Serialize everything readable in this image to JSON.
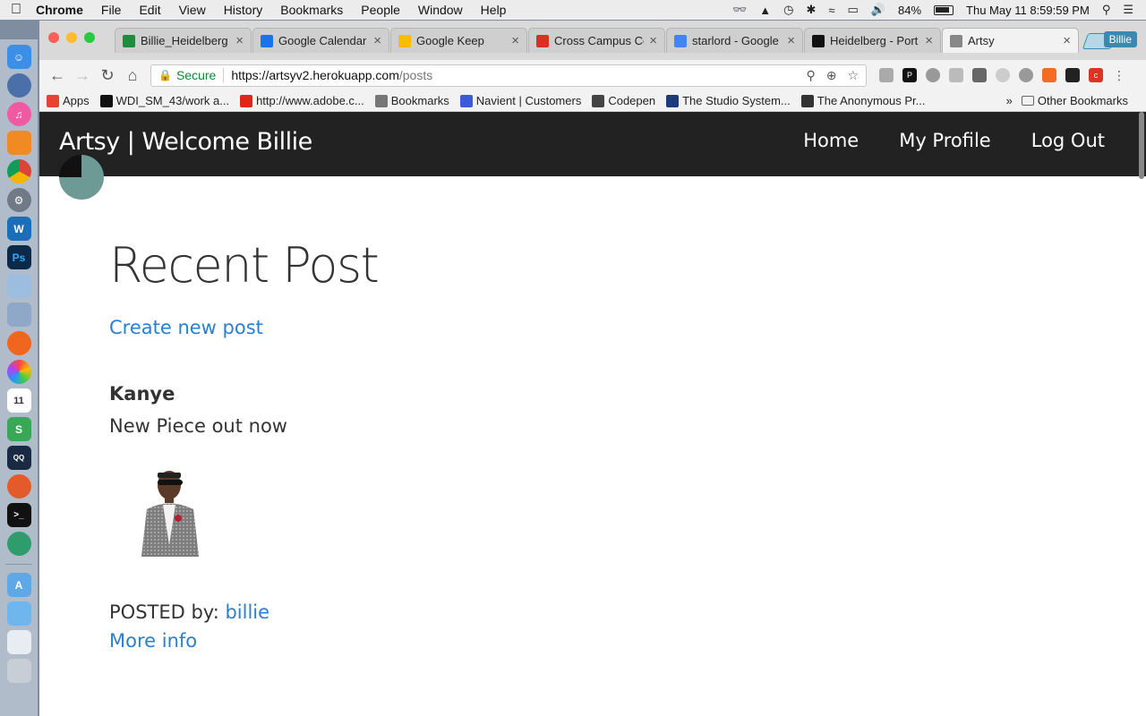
{
  "menubar": {
    "app": "Chrome",
    "items": [
      "File",
      "Edit",
      "View",
      "History",
      "Bookmarks",
      "People",
      "Window",
      "Help"
    ],
    "battery": "84%",
    "datetime": "Thu May 11  8:59:59 PM"
  },
  "browser": {
    "profile": "Billie",
    "tabs": [
      {
        "title": "Billie_Heidelberg",
        "favicon_color": "#1e8e3e",
        "favicon": "sheets-icon"
      },
      {
        "title": "Google Calendar",
        "favicon_color": "#1a73e8",
        "favicon": "calendar-icon"
      },
      {
        "title": "Google Keep",
        "favicon_color": "#fbbc04",
        "favicon": "keep-icon"
      },
      {
        "title": "Cross Campus Co",
        "favicon_color": "#d93025",
        "favicon": "gmail-icon"
      },
      {
        "title": "starlord - Google",
        "favicon_color": "#4285f4",
        "favicon": "google-icon"
      },
      {
        "title": "Heidelberg - Port",
        "favicon_color": "#111111",
        "favicon": "portfolio-icon"
      },
      {
        "title": "Artsy",
        "favicon_color": "#888888",
        "favicon": "page-icon"
      }
    ],
    "omnibox": {
      "secure_label": "Secure",
      "url_host": "https://artsyv2.herokuapp.com",
      "url_path": "/posts"
    },
    "bookmarks": [
      {
        "label": "Apps",
        "icon": "apps-grid-icon",
        "color": "#e94235"
      },
      {
        "label": "WDI_SM_43/work a...",
        "icon": "github-icon",
        "color": "#111111"
      },
      {
        "label": "http://www.adobe.c...",
        "icon": "adobe-icon",
        "color": "#e1251b"
      },
      {
        "label": "Bookmarks",
        "icon": "star-icon",
        "color": "#777777"
      },
      {
        "label": "Navient | Customers",
        "icon": "navient-icon",
        "color": "#3b5bdb"
      },
      {
        "label": "Codepen",
        "icon": "codepen-icon",
        "color": "#444444"
      },
      {
        "label": "The Studio System...",
        "icon": "studio-icon",
        "color": "#1d3b7a"
      },
      {
        "label": "The Anonymous Pr...",
        "icon": "anonymous-icon",
        "color": "#333333"
      }
    ],
    "other_bookmarks": "Other Bookmarks"
  },
  "site": {
    "brand": "Artsy | Welcome Billie",
    "nav": [
      "Home",
      "My Profile",
      "Log Out"
    ],
    "heading": "Recent Post",
    "create_link": "Create new post",
    "post": {
      "title": "Kanye",
      "body": "New Piece out now",
      "posted_prefix": "POSTED by:",
      "author": "billie",
      "more_link": "More info"
    }
  }
}
